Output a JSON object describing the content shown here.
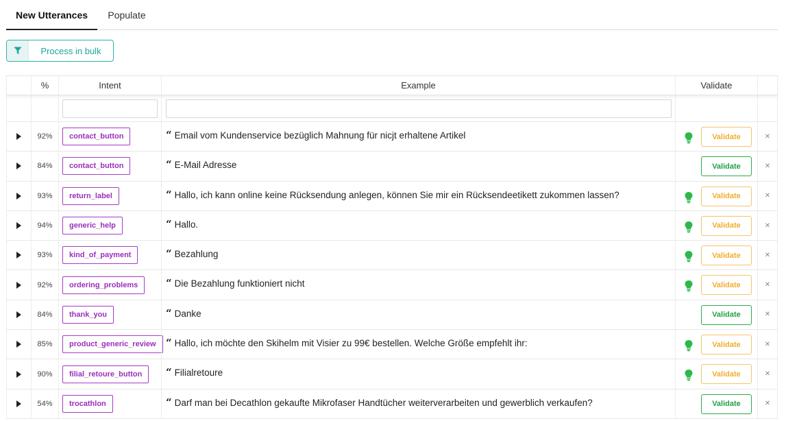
{
  "tabs": [
    {
      "label": "New Utterances",
      "active": true
    },
    {
      "label": "Populate",
      "active": false
    }
  ],
  "toolbar": {
    "bulk_label": "Process in bulk",
    "bulk_icon": "filter-icon"
  },
  "table": {
    "headers": {
      "pct": "%",
      "intent": "Intent",
      "example": "Example",
      "validate": "Validate"
    },
    "filters": {
      "intent_value": "",
      "example_value": ""
    },
    "rows": [
      {
        "pct": "92%",
        "intent": "contact_button",
        "example": "Email vom Kundenservice bezüglich Mahnung für nicjt erhaltene Artikel",
        "suggested": true,
        "validate": "Validate"
      },
      {
        "pct": "84%",
        "intent": "contact_button",
        "example": "E-Mail Adresse",
        "suggested": false,
        "validate": "Validate"
      },
      {
        "pct": "93%",
        "intent": "return_label",
        "example": "Hallo, ich kann online keine Rücksendung anlegen, können Sie mir ein Rücksendeetikett zukommen lassen?",
        "suggested": true,
        "validate": "Validate"
      },
      {
        "pct": "94%",
        "intent": "generic_help",
        "example": "Hallo.",
        "suggested": true,
        "validate": "Validate"
      },
      {
        "pct": "93%",
        "intent": "kind_of_payment",
        "example": "Bezahlung",
        "suggested": true,
        "validate": "Validate"
      },
      {
        "pct": "92%",
        "intent": "ordering_problems",
        "example": "Die Bezahlung funktioniert nicht",
        "suggested": true,
        "validate": "Validate"
      },
      {
        "pct": "84%",
        "intent": "thank_you",
        "example": "Danke",
        "suggested": false,
        "validate": "Validate"
      },
      {
        "pct": "85%",
        "intent": "product_generic_review",
        "example": "Hallo, ich möchte den Skihelm mit Visier zu 99€ bestellen. Welche Größe empfehlt ihr:",
        "suggested": true,
        "validate": "Validate"
      },
      {
        "pct": "90%",
        "intent": "filial_retoure_button",
        "example": "Filialretoure",
        "suggested": true,
        "validate": "Validate"
      },
      {
        "pct": "54%",
        "intent": "trocathlon",
        "example": "Darf man bei Decathlon gekaufte Mikrofaser Handtücher weiterverarbeiten und gewerblich verkaufen?",
        "suggested": false,
        "validate": "Validate"
      }
    ]
  },
  "icons": {
    "expand": "caret-right-icon",
    "quote": "quote-icon",
    "suggestion": "lightbulb-icon",
    "delete": "close-icon"
  },
  "colors": {
    "accent": "#18a99b",
    "intent": "#9b2fba",
    "warn": "#f0ad2e",
    "ok": "#22a046",
    "bulb": "#2eb84b"
  }
}
